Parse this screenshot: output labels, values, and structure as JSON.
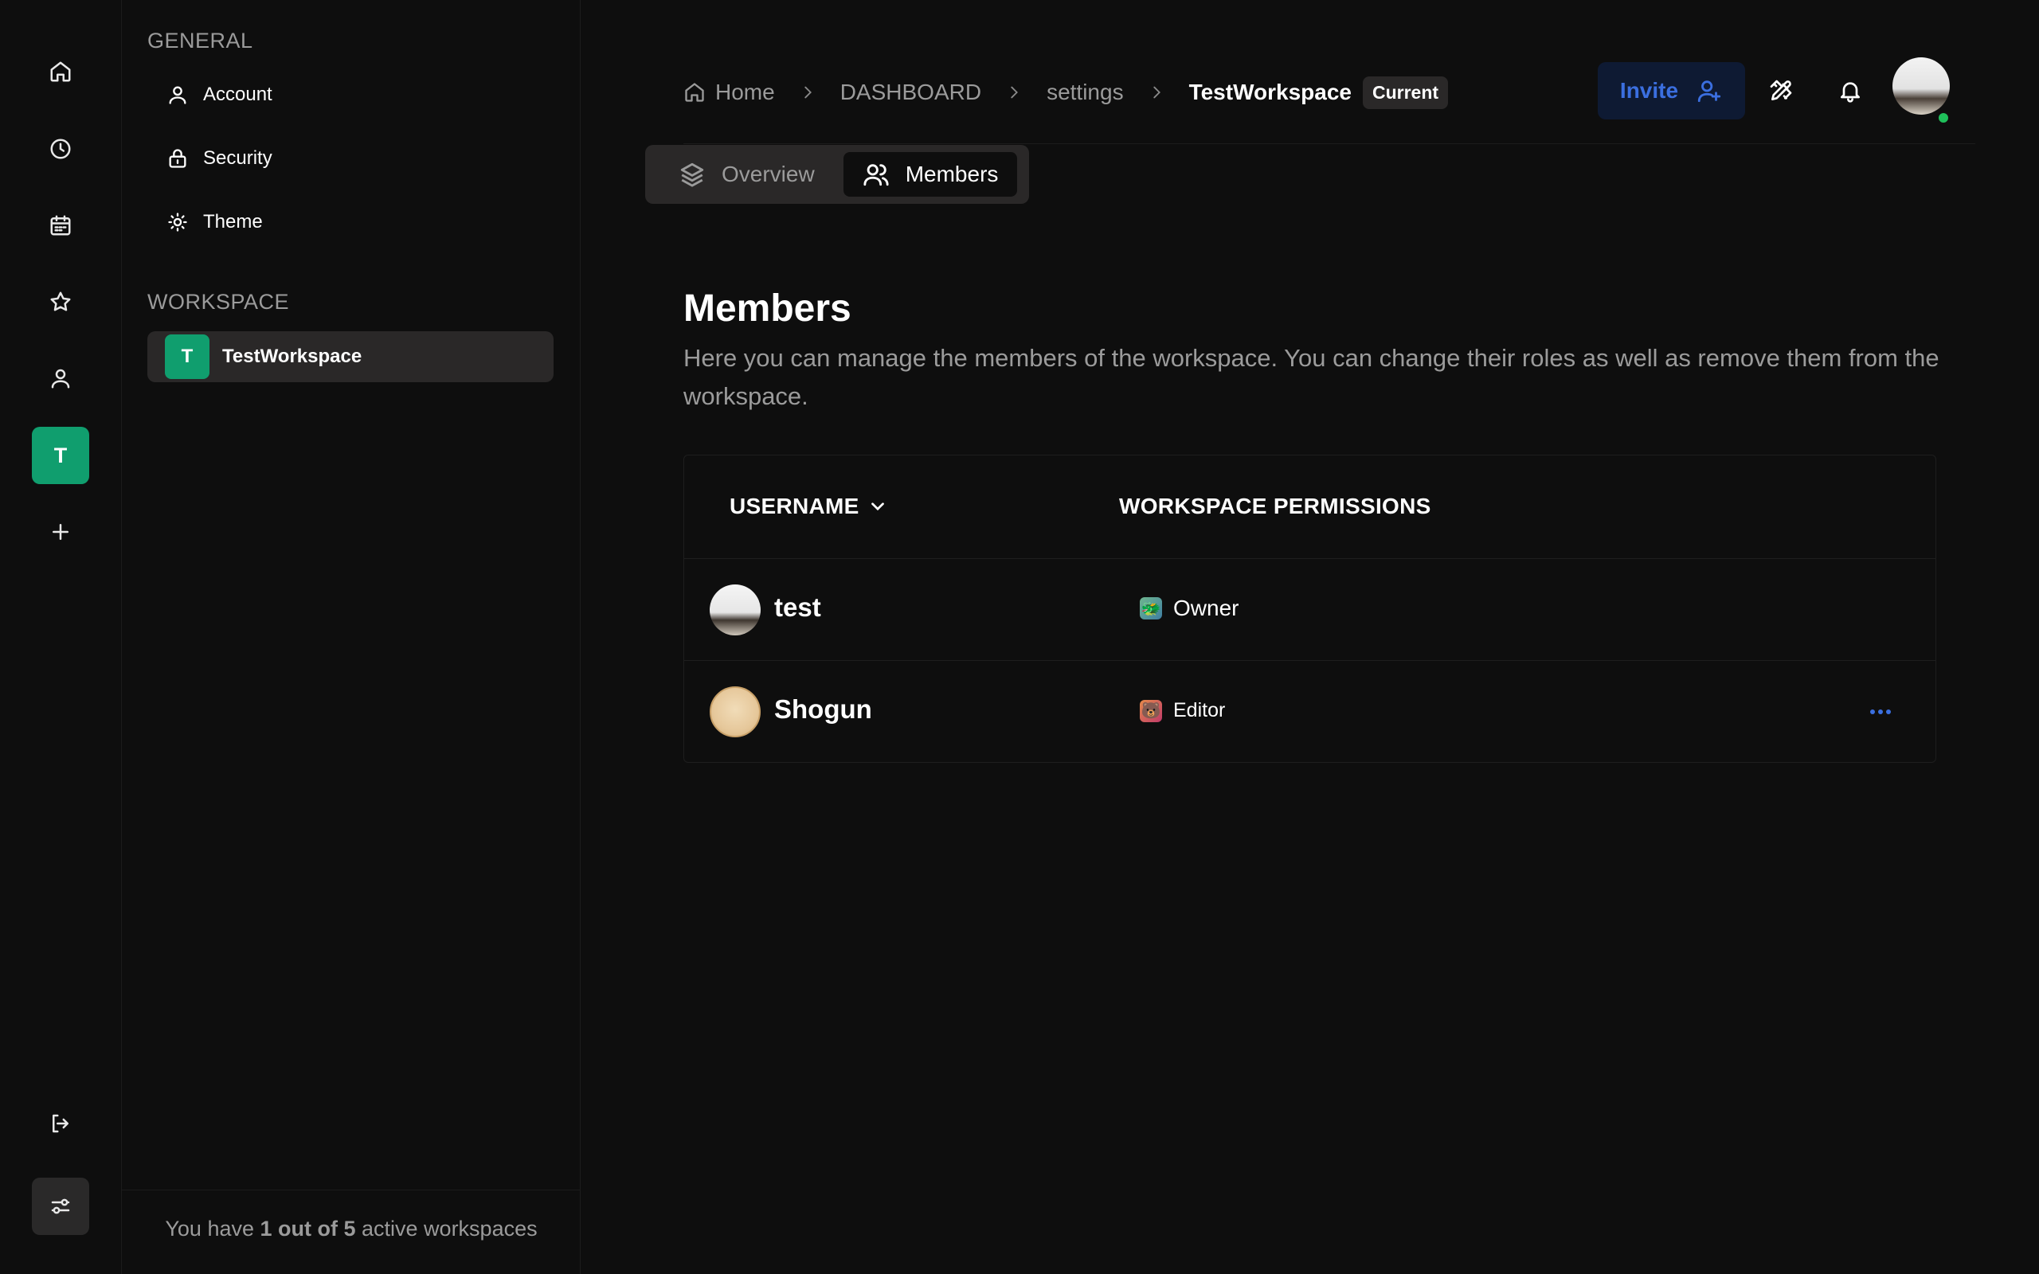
{
  "rail": {
    "items": [
      {
        "icon": "home-icon"
      },
      {
        "icon": "clock-icon"
      },
      {
        "icon": "calendar-icon"
      },
      {
        "icon": "star-icon"
      },
      {
        "icon": "user-icon"
      }
    ],
    "workspace_initial": "T",
    "add_icon": "plus-icon",
    "logout_icon": "logout-icon",
    "settings_icon": "sliders-icon"
  },
  "panel": {
    "general_heading": "GENERAL",
    "general_items": [
      {
        "label": "Account",
        "icon": "user-icon"
      },
      {
        "label": "Security",
        "icon": "lock-icon"
      },
      {
        "label": "Theme",
        "icon": "sun-icon"
      }
    ],
    "workspace_heading": "WORKSPACE",
    "workspace_item": {
      "initial": "T",
      "label": "TestWorkspace"
    },
    "footer": {
      "prefix": "You have ",
      "count": "1 out of 5",
      "suffix": " active workspaces"
    }
  },
  "breadcrumb": {
    "home": "Home",
    "dashboard": "DASHBOARD",
    "settings": "settings",
    "current": "TestWorkspace",
    "badge": "Current"
  },
  "header": {
    "invite_label": "Invite",
    "accent": "#3b6fe0",
    "online_color": "#1fbf5a"
  },
  "tabs": [
    {
      "label": "Overview",
      "icon": "layers-icon"
    },
    {
      "label": "Members",
      "icon": "users-icon"
    }
  ],
  "main": {
    "title": "Members",
    "description": "Here you can manage the members of the workspace. You can change their roles as well as remove them from the workspace."
  },
  "table": {
    "columns": [
      "USERNAME",
      "WORKSPACE PERMISSIONS"
    ],
    "rows": [
      {
        "name": "test",
        "role": "Owner",
        "role_emoji": "🐲"
      },
      {
        "name": "Shogun",
        "role": "Editor",
        "role_emoji": "🐻"
      }
    ]
  },
  "colors": {
    "workspace_green": "#109e6e",
    "background": "#0e0e0e"
  }
}
